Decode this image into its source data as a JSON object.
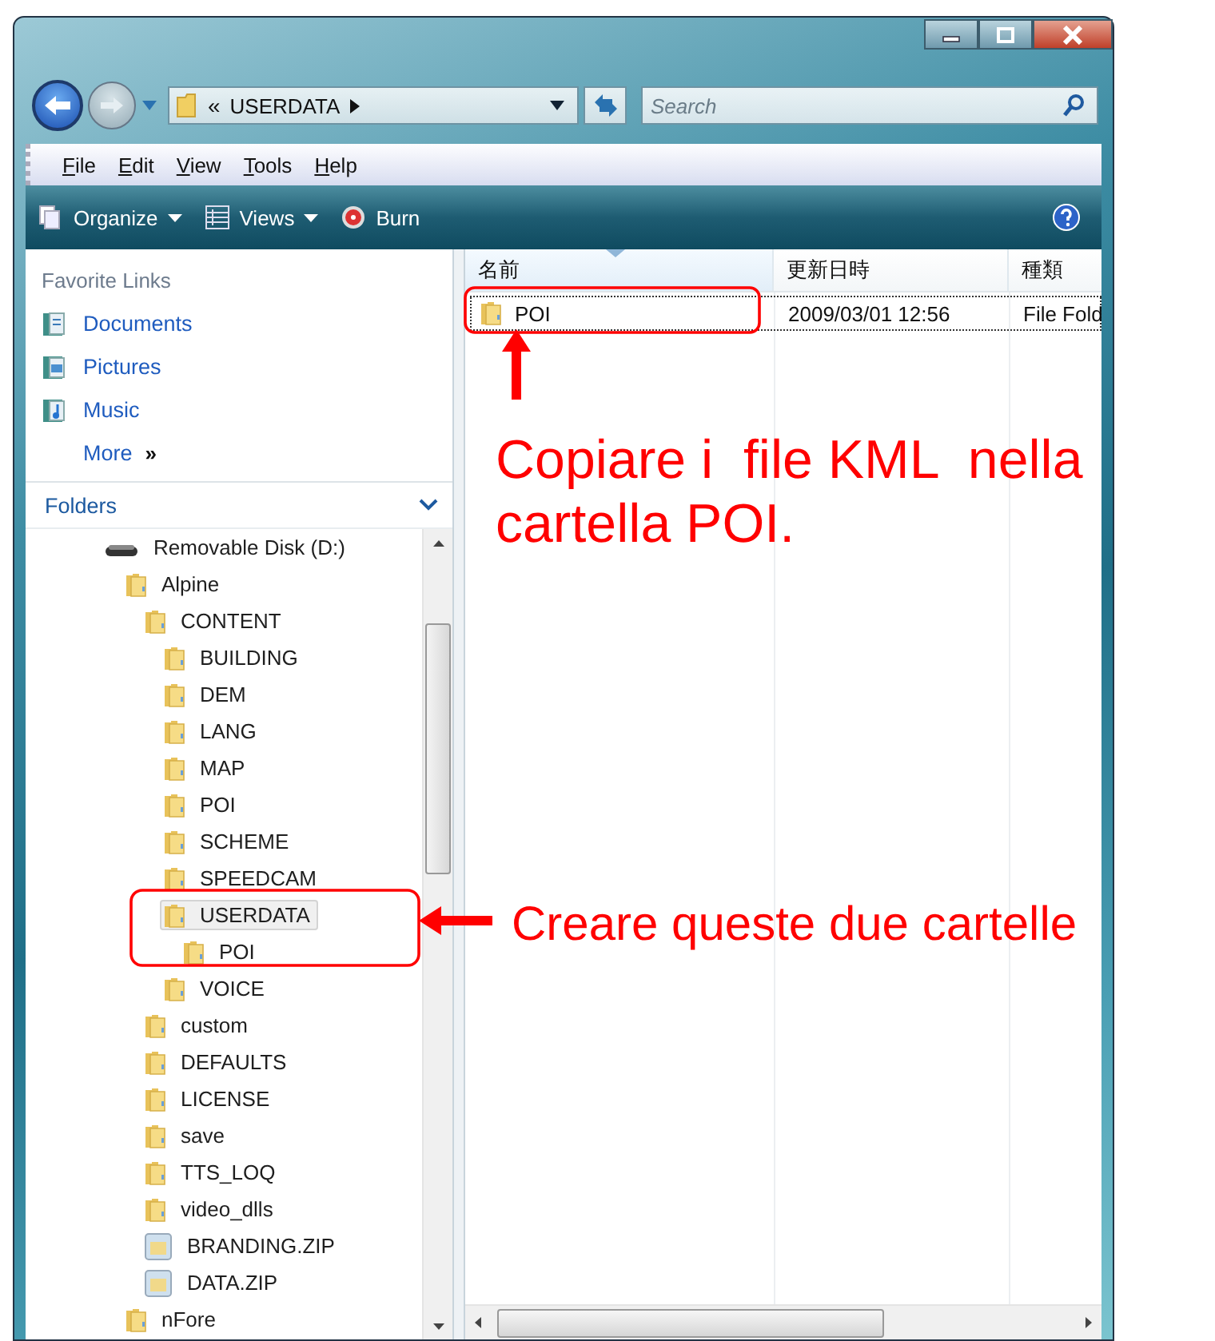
{
  "address": {
    "overflow": "«",
    "path": "USERDATA"
  },
  "search": {
    "placeholder": "Search"
  },
  "menu": [
    {
      "label": "File",
      "mnemonic": true
    },
    {
      "label": "Edit",
      "mnemonic": true
    },
    {
      "label": "View",
      "mnemonic": true
    },
    {
      "label": "Tools",
      "mnemonic": true
    },
    {
      "label": "Help",
      "mnemonic": true
    }
  ],
  "toolbar": [
    {
      "label": "Organize",
      "kind": "organize",
      "dropdown": true
    },
    {
      "label": "Views",
      "kind": "views",
      "dropdown": true
    },
    {
      "label": "Burn",
      "kind": "burn",
      "dropdown": false
    }
  ],
  "favorite_links": {
    "title": "Favorite Links",
    "items": [
      {
        "label": "Documents",
        "kind": "documents"
      },
      {
        "label": "Pictures",
        "kind": "pictures"
      },
      {
        "label": "Music",
        "kind": "music"
      },
      {
        "label": "More",
        "kind": "more",
        "suffix": "»"
      }
    ]
  },
  "folders": {
    "title": "Folders",
    "tree": [
      {
        "label": "Removable Disk (D:)",
        "kind": "drive",
        "selected": false,
        "children": [
          {
            "label": "Alpine",
            "kind": "folder",
            "selected": false,
            "children": [
              {
                "label": "CONTENT",
                "kind": "folder",
                "selected": false,
                "children": [
                  {
                    "label": "BUILDING",
                    "kind": "folder",
                    "selected": false
                  },
                  {
                    "label": "DEM",
                    "kind": "folder",
                    "selected": false
                  },
                  {
                    "label": "LANG",
                    "kind": "folder",
                    "selected": false
                  },
                  {
                    "label": "MAP",
                    "kind": "folder",
                    "selected": false
                  },
                  {
                    "label": "POI",
                    "kind": "folder",
                    "selected": false
                  },
                  {
                    "label": "SCHEME",
                    "kind": "folder",
                    "selected": false
                  },
                  {
                    "label": "SPEEDCAM",
                    "kind": "folder",
                    "selected": false
                  },
                  {
                    "label": "USERDATA",
                    "kind": "folder",
                    "selected": true,
                    "children": [
                      {
                        "label": "POI",
                        "kind": "folder",
                        "selected": false
                      }
                    ]
                  },
                  {
                    "label": "VOICE",
                    "kind": "folder",
                    "selected": false
                  }
                ]
              },
              {
                "label": "custom",
                "kind": "folder",
                "selected": false
              },
              {
                "label": "DEFAULTS",
                "kind": "folder",
                "selected": false
              },
              {
                "label": "LICENSE",
                "kind": "folder",
                "selected": false
              },
              {
                "label": "save",
                "kind": "folder",
                "selected": false
              },
              {
                "label": "TTS_LOQ",
                "kind": "folder",
                "selected": false
              },
              {
                "label": "video_dlls",
                "kind": "folder",
                "selected": false
              },
              {
                "label": "BRANDING.ZIP",
                "kind": "zip",
                "selected": false
              },
              {
                "label": "DATA.ZIP",
                "kind": "zip",
                "selected": false
              }
            ]
          },
          {
            "label": "nFore",
            "kind": "folder",
            "selected": false
          }
        ]
      }
    ]
  },
  "file_list": {
    "columns": [
      {
        "label": "名前",
        "sorted": true
      },
      {
        "label": "更新日時",
        "sorted": false
      },
      {
        "label": "種類",
        "sorted": false
      }
    ],
    "rows": [
      {
        "kind": "folder",
        "focused": true,
        "cells": [
          "POI",
          "2009/03/01 12:56",
          "File Fold"
        ]
      }
    ]
  },
  "annotations": [
    {
      "kind": "note",
      "text": "Copiare i  file KML  nella cartella POI."
    },
    {
      "kind": "note",
      "text": "Creare queste due cartelle"
    }
  ]
}
